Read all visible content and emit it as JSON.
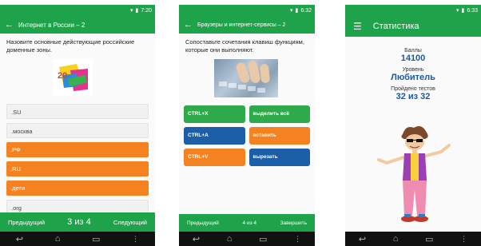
{
  "phone1": {
    "status": {
      "time": "7:20"
    },
    "appbar": {
      "title": "Интернет в России – 2"
    },
    "question": "Назовите основные действующие российские доменные зоны.",
    "image_text": "20 лет рунету",
    "answers": [
      {
        "label": ".SU",
        "style": "white"
      },
      {
        "label": ".москва",
        "style": "white"
      },
      {
        "label": ".РФ",
        "style": "orange"
      },
      {
        "label": ".RU",
        "style": "orange"
      },
      {
        "label": ".дети",
        "style": "orange"
      },
      {
        "label": ".org",
        "style": "white"
      }
    ],
    "footer": {
      "prev_label": "Предыдущий",
      "page": "3 из 4",
      "next_label": "Следующий"
    }
  },
  "phone2": {
    "status": {
      "time": "6:32"
    },
    "appbar": {
      "title": "Браузеры и интернет-сервисы – 2"
    },
    "question": "Сопоставьте сочетания клавиш функциям, которые они выполняют.",
    "tiles": [
      {
        "label": "CTRL+X",
        "color": "green"
      },
      {
        "label": "выделить всё",
        "color": "green"
      },
      {
        "label": "CTRL+A",
        "color": "blue"
      },
      {
        "label": "вставить",
        "color": "orange"
      },
      {
        "label": "CTRL+V",
        "color": "orange"
      },
      {
        "label": "вырезать",
        "color": "blue"
      }
    ],
    "footer": {
      "prev_label": "Предыдущий",
      "page": "4 из 4",
      "finish_label": "Завершить"
    }
  },
  "phone3": {
    "status": {
      "time": "6:33"
    },
    "appbar": {
      "title": "Статистика"
    },
    "stats": {
      "score_label": "Баллы",
      "score_value": "14100",
      "level_label": "Уровень",
      "level_value": "Любитель",
      "tests_label": "Пройдено тестов",
      "tests_value": "32 из 32"
    }
  },
  "colors": {
    "green": "#1fa34a",
    "orange": "#f58220",
    "blue": "#1c5fa8",
    "stat_value": "#1a5aa0"
  }
}
